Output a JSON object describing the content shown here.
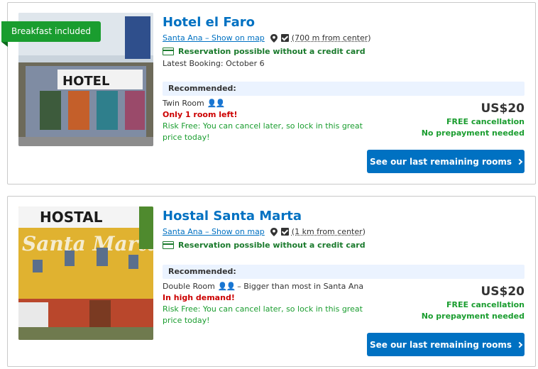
{
  "hotels": [
    {
      "badge": "Breakfast included",
      "name": "Hotel el Faro",
      "location_link": "Santa Ana – Show on map",
      "distance": "(700 m from center)",
      "no_cc": "Reservation possible without a credit card",
      "latest_booking": "Latest Booking: October 6",
      "recommended": "Recommended:",
      "room_type": "Twin Room",
      "room_extra": "",
      "urgency": "Only 1 room left!",
      "risk_free": "Risk Free: You can cancel later, so lock in this great price today!",
      "price": "US$20",
      "free_cancel": "FREE cancellation",
      "no_prepay": "No prepayment needed",
      "cta": "See our last remaining rooms",
      "photo_sign": "HOTEL"
    },
    {
      "badge": "",
      "name": "Hostal Santa Marta",
      "location_link": "Santa Ana – Show on map",
      "distance": "(1 km from center)",
      "no_cc": "Reservation possible without a credit card",
      "latest_booking": "",
      "recommended": "Recommended:",
      "room_type": "Double Room",
      "room_extra": "– Bigger than most in Santa Ana",
      "urgency": "In high demand!",
      "risk_free": "Risk Free: You can cancel later, so lock in this great price today!",
      "price": "US$20",
      "free_cancel": "FREE cancellation",
      "no_prepay": "No prepayment needed",
      "cta": "See our last remaining rooms",
      "photo_sign": "HOSTAL",
      "photo_script": "Santa Marta"
    }
  ],
  "colors": {
    "brand_blue": "#0071c2",
    "green": "#1a9d2f",
    "red": "#cc0000",
    "rec_bg": "#ebf3ff"
  },
  "icons": [
    "map-pin-icon",
    "checkbox-icon",
    "credit-card-icon",
    "persons-icon",
    "chevron-right-icon"
  ]
}
